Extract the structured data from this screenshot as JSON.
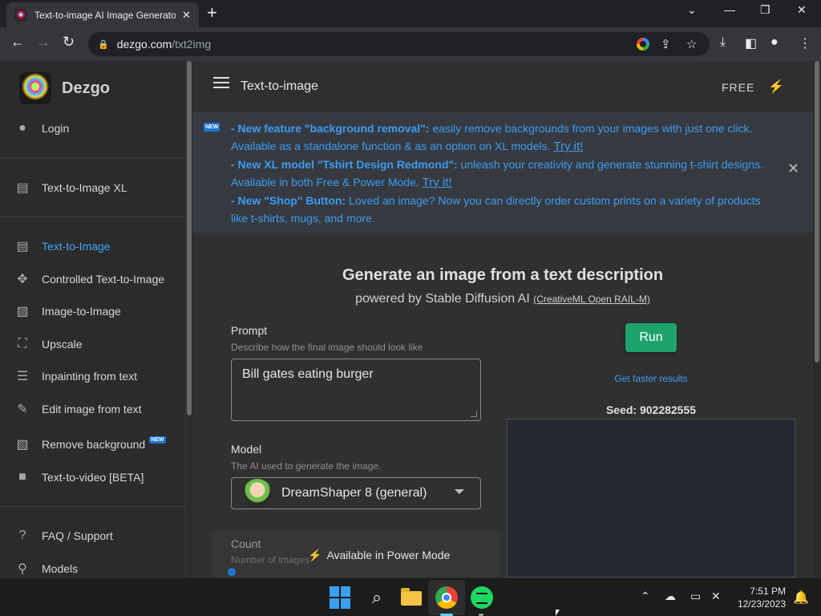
{
  "browser": {
    "tab_title": "Text-to-image AI Image Generator",
    "tab_close": "✕",
    "new_tab": "+",
    "url_host": "dezgo.com",
    "url_path": "/txt2img"
  },
  "sidebar": {
    "brand": "Dezgo",
    "login": "Login",
    "items_top": [
      {
        "label": "Text-to-Image XL",
        "icon": "chat-icon"
      }
    ],
    "items": [
      {
        "label": "Text-to-Image",
        "icon": "chat-icon",
        "active": true
      },
      {
        "label": "Controlled Text-to-Image",
        "icon": "move-icon"
      },
      {
        "label": "Image-to-Image",
        "icon": "image-icon"
      },
      {
        "label": "Upscale",
        "icon": "upscale-icon"
      },
      {
        "label": "Inpainting from text",
        "icon": "list-icon"
      },
      {
        "label": "Edit image from text",
        "icon": "edit-icon"
      },
      {
        "label": "Remove background",
        "icon": "hide-image-icon",
        "badge": "NEW"
      },
      {
        "label": "Text-to-video [BETA]",
        "icon": "video-icon"
      }
    ],
    "items_bottom": [
      {
        "label": "FAQ / Support",
        "icon": "question-icon"
      },
      {
        "label": "Models",
        "icon": "pin-icon"
      }
    ]
  },
  "appbar": {
    "title": "Text-to-image",
    "plan": "FREE"
  },
  "announcement": {
    "badge": "NEW",
    "line1_bold": "- New feature \"background removal\":",
    "line1_text": " easily remove backgrounds from your images with just one click. Available as a standalone function & as an option on XL models. ",
    "line1_link": "Try it!",
    "line2_bold": "- New XL model \"Tshirt Design Redmond\":",
    "line2_text": " unleash your creativity and generate stunning t-shirt designs. Available in both Free & Power Mode. ",
    "line2_link": "Try it!",
    "line3_bold": "- New \"Shop\" Button:",
    "line3_text": " Loved an image? Now you can directly order custom prints on a variety of products like t-shirts, mugs, and more."
  },
  "hero": {
    "title": "Generate an image from a text description",
    "subtitle": "powered by Stable Diffusion AI ",
    "license": "(CreativeML Open RAIL-M)"
  },
  "form": {
    "prompt_label": "Prompt",
    "prompt_help": "Describe how the final image should look like",
    "prompt_value": "Bill gates eating burger",
    "model_label": "Model",
    "model_help": "The AI used to generate the image.",
    "model_value": "DreamShaper 8 (general)",
    "count_label": "Count",
    "count_help": "Number of images",
    "power_mode": "Available in Power Mode"
  },
  "actions": {
    "run": "Run",
    "faster": "Get faster results",
    "seed": "Seed: 902282555"
  },
  "taskbar": {
    "time": "7:51 PM",
    "date": "12/23/2023"
  },
  "colors": {
    "accent_blue": "#3d9bf0",
    "run_green": "#1ea36e"
  }
}
